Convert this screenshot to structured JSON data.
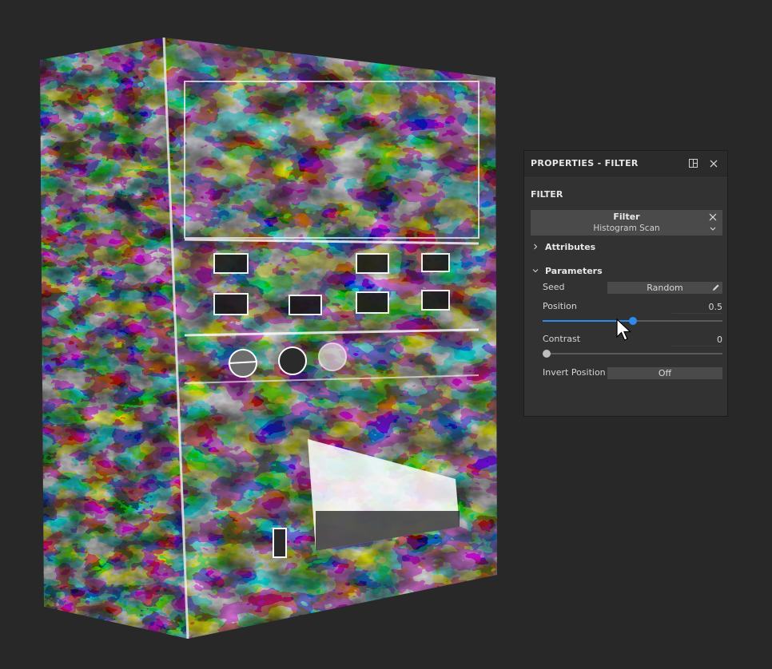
{
  "panel": {
    "title": "PROPERTIES - FILTER",
    "section": "FILTER",
    "filter": {
      "label": "Filter",
      "value": "Histogram Scan"
    },
    "groups": {
      "attributes": "Attributes",
      "parameters": "Parameters"
    },
    "params": {
      "seed": {
        "label": "Seed",
        "value": "Random"
      },
      "position": {
        "label": "Position",
        "value": "0.5",
        "fraction": 0.5
      },
      "contrast": {
        "label": "Contrast",
        "value": "0",
        "fraction": 0
      },
      "invert": {
        "label": "Invert Position",
        "value": "Off"
      }
    }
  },
  "colors": {
    "accent": "#2d8ceb",
    "panel_bg": "#323232",
    "viewport_bg": "#282828"
  },
  "icons": [
    "dock-icon",
    "close-icon",
    "chevron-down-icon",
    "chevron-right-icon",
    "pencil-icon",
    "mouse-cursor-icon"
  ]
}
